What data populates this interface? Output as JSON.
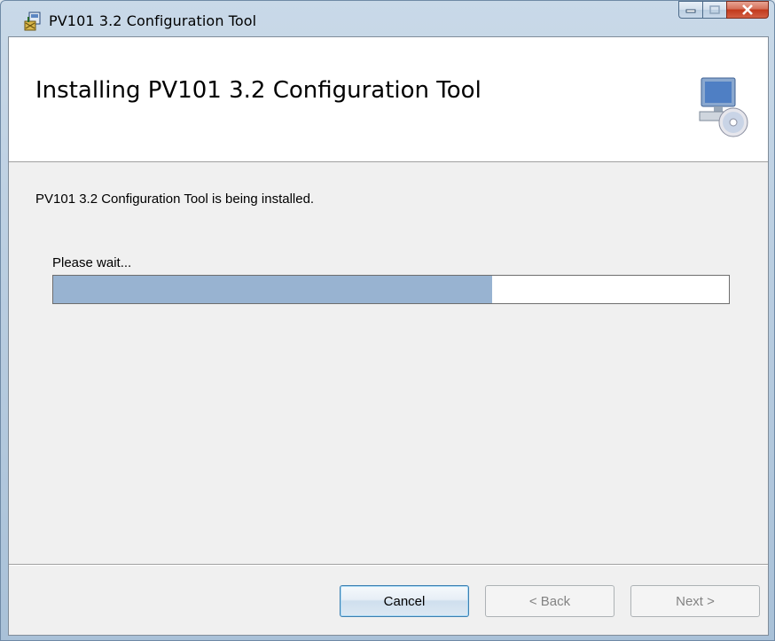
{
  "window": {
    "title": "PV101 3.2 Configuration Tool"
  },
  "banner": {
    "title": "Installing PV101 3.2 Configuration Tool"
  },
  "status": {
    "message": "PV101 3.2 Configuration Tool is being installed.",
    "wait_label": "Please wait...",
    "progress_fraction": 0.65
  },
  "buttons": {
    "cancel": "Cancel",
    "back": "< Back",
    "next": "Next >"
  },
  "colors": {
    "progress_fill": "#98b3d1",
    "close_button": "#c2391c"
  },
  "icons": {
    "app": "installer-package-icon",
    "banner": "computer-with-disc-icon"
  }
}
